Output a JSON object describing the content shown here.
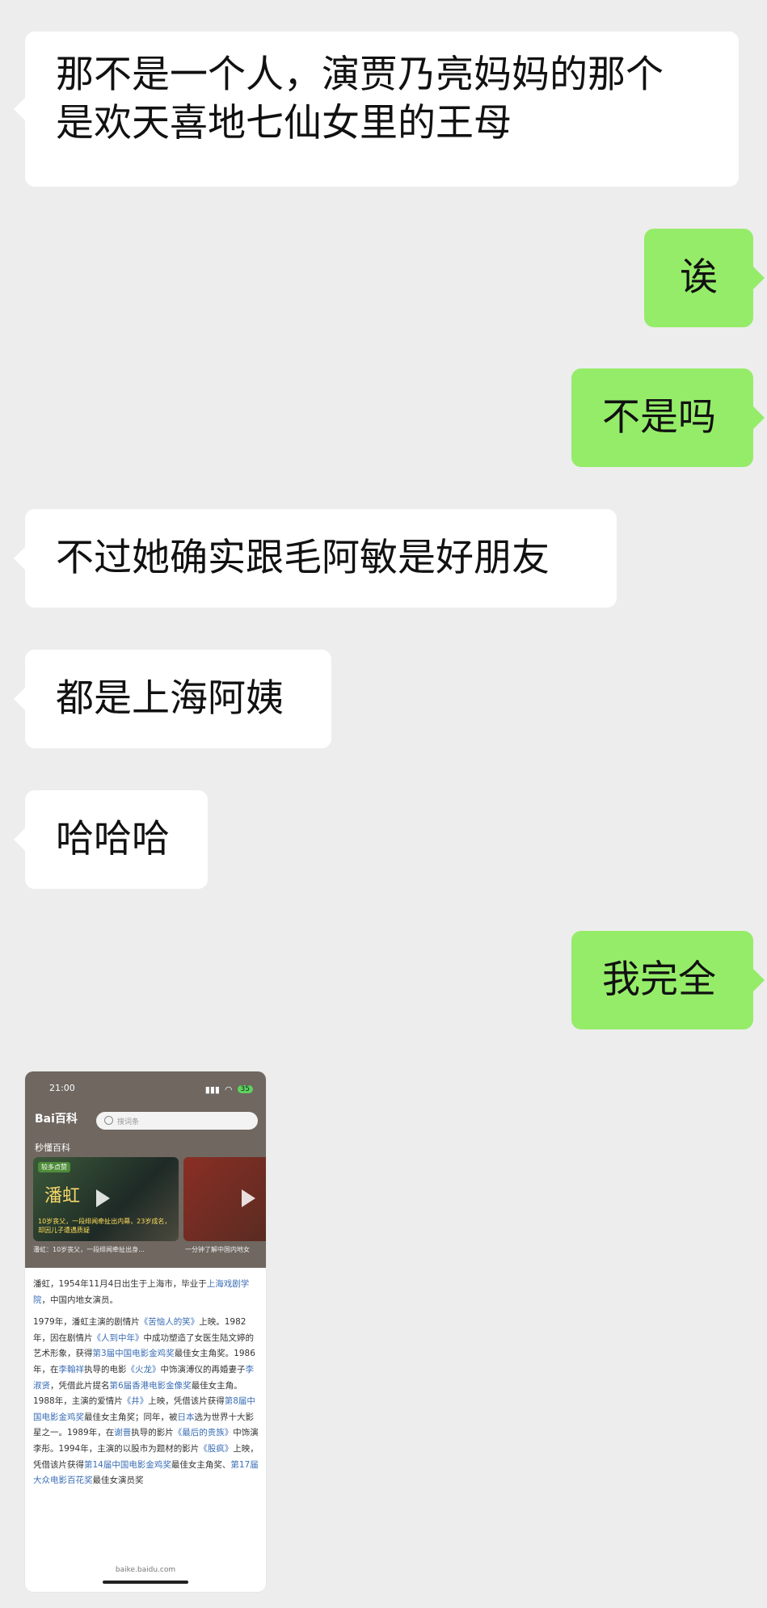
{
  "messages": [
    {
      "side": "left",
      "text_line1": "那不是一个人，演贾乃亮妈妈的那个",
      "text_line2": "是欢天喜地七仙女里的王母"
    },
    {
      "side": "right",
      "text": "诶"
    },
    {
      "side": "right",
      "text": "不是吗"
    },
    {
      "side": "left",
      "text": "不过她确实跟毛阿敏是好朋友"
    },
    {
      "side": "left",
      "text": "都是上海阿姨"
    },
    {
      "side": "left",
      "text": "哈哈哈"
    },
    {
      "side": "right",
      "text": "我完全"
    }
  ],
  "screenshot": {
    "status_time": "21:00",
    "battery": "35",
    "logo": "Bai百科",
    "search_placeholder": "搜词条",
    "section_label": "秒懂百科",
    "video1": {
      "badge": "较多点赞",
      "title": "潘虹",
      "overlay": "10岁丧父，一段绯闻牵扯出内幕，23岁成名，却因儿子遭遇质疑",
      "caption": "潘虹：10岁丧父，一段绯闻牵扯出身..."
    },
    "video2": {
      "caption": "一分钟了解中国内地女"
    },
    "intro": {
      "pre": "潘虹，1954年11月4日出生于上海市，毕业于",
      "link": "上海戏剧学院",
      "post": "，中国内地女演员。"
    },
    "bio": [
      {
        "t": "1979年，潘虹主演的剧情片"
      },
      {
        "t": "《苦恼人的笑》",
        "link": true
      },
      {
        "t": "上映。1982年，因在剧情片"
      },
      {
        "t": "《人到中年》",
        "link": true
      },
      {
        "t": "中成功塑造了女医生陆文婷的艺术形象，获得"
      },
      {
        "t": "第3届中国电影金鸡奖",
        "link": true
      },
      {
        "t": "最佳女主角奖。1986年，在"
      },
      {
        "t": "李翰祥",
        "link": true
      },
      {
        "t": "执导的电影"
      },
      {
        "t": "《火龙》",
        "link": true
      },
      {
        "t": "中饰演溥仪的再婚妻子"
      },
      {
        "t": "李淑贤",
        "link": true
      },
      {
        "t": "，凭借此片提名"
      },
      {
        "t": "第6届香港电影金像奖",
        "link": true
      },
      {
        "t": "最佳女主角。1988年，主演的爱情片"
      },
      {
        "t": "《井》",
        "link": true
      },
      {
        "t": "上映，凭借该片获得"
      },
      {
        "t": "第8届中国电影金鸡奖",
        "link": true
      },
      {
        "t": "最佳女主角奖；同年，被"
      },
      {
        "t": "日本",
        "link": true
      },
      {
        "t": "选为世界十大影星之一。1989年，在"
      },
      {
        "t": "谢晋",
        "link": true
      },
      {
        "t": "执导的影片"
      },
      {
        "t": "《最后的贵族》",
        "link": true
      },
      {
        "t": "中饰演李彤。1994年，主演的以股市为题材的影片"
      },
      {
        "t": "《股疯》",
        "link": true
      },
      {
        "t": "上映，凭借该片获得"
      },
      {
        "t": "第14届中国电影金鸡奖",
        "link": true
      },
      {
        "t": "最佳女主角奖、"
      },
      {
        "t": "第17届大众电影百花奖",
        "link": true
      },
      {
        "t": "最佳女演员奖"
      }
    ],
    "footer_url": "baike.baidu.com"
  },
  "colors": {
    "background": "#ededed",
    "bubble_left": "#ffffff",
    "bubble_right": "#95ec69",
    "link": "#3a6eb5"
  }
}
